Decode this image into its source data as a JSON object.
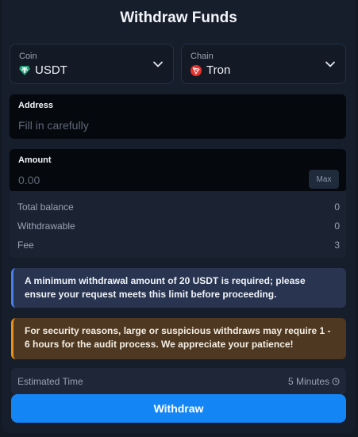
{
  "title": "Withdraw Funds",
  "coin": {
    "label": "Coin",
    "value": "USDT",
    "icon": "tether-icon",
    "icon_color": "#26a17b"
  },
  "chain": {
    "label": "Chain",
    "value": "Tron",
    "icon": "tron-icon",
    "icon_color": "#e5322d"
  },
  "address": {
    "label": "Address",
    "placeholder": "Fill in carefully"
  },
  "amount": {
    "label": "Amount",
    "placeholder": "0.00",
    "max_label": "Max"
  },
  "stats": [
    {
      "label": "Total balance",
      "value": "0"
    },
    {
      "label": "Withdrawable",
      "value": "0"
    },
    {
      "label": "Fee",
      "value": "3"
    }
  ],
  "notices": {
    "info": "A minimum withdrawal amount of 20 USDT is required; please ensure your request meets this limit before proceeding.",
    "warning": "For security reasons, large or suspicious withdraws may require 1 - 6 hours for the audit process. We appreciate your patience!"
  },
  "estimated": {
    "label": "Estimated Time",
    "value": "5 Minutes",
    "icon": "clock-icon"
  },
  "submit_label": "Withdraw",
  "colors": {
    "accent": "#1485f5",
    "info": "#4a7ee8",
    "warning": "#e8901c"
  }
}
